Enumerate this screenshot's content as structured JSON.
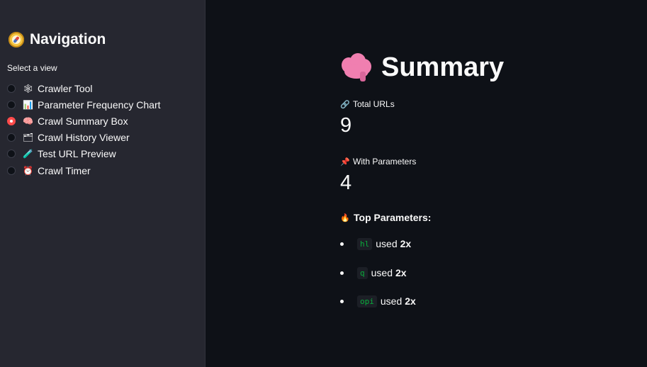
{
  "sidebar": {
    "title": "Navigation",
    "title_icon": "compass-icon",
    "select_label": "Select a view",
    "options": [
      {
        "label": "Crawler Tool",
        "icon": "spider-icon",
        "glyph": "🕸",
        "selected": false
      },
      {
        "label": "Parameter Frequency Chart",
        "icon": "bar-chart-icon",
        "glyph": "📊",
        "selected": false
      },
      {
        "label": "Crawl Summary Box",
        "icon": "brain-icon",
        "glyph": "🧠",
        "selected": true
      },
      {
        "label": "Crawl History Viewer",
        "icon": "folder-icon",
        "glyph": "🗂",
        "selected": false
      },
      {
        "label": "Test URL Preview",
        "icon": "test-tube-icon",
        "glyph": "🧪",
        "selected": false
      },
      {
        "label": "Crawl Timer",
        "icon": "alarm-clock-icon",
        "glyph": "⏰",
        "selected": false
      }
    ]
  },
  "main": {
    "title": "Summary",
    "title_icon": "brain-icon",
    "metrics": [
      {
        "label": "Total URLs",
        "icon": "link-icon",
        "glyph": "🔗",
        "value": "9"
      },
      {
        "label": "With Parameters",
        "icon": "pushpin-icon",
        "glyph": "📌",
        "value": "4"
      }
    ],
    "top_params_heading": "Top Parameters:",
    "top_params_icon": "fire-icon",
    "top_params_glyph": "🔥",
    "params": [
      {
        "name": "hl",
        "used_text": "used",
        "count": "2x"
      },
      {
        "name": "q",
        "used_text": "used",
        "count": "2x"
      },
      {
        "name": "opi",
        "used_text": "used",
        "count": "2x"
      }
    ]
  },
  "colors": {
    "sidebar_bg": "#262730",
    "main_bg": "#0e1117",
    "accent": "#ff4b4b",
    "code": "#09ab3b",
    "text": "#fafafa"
  }
}
